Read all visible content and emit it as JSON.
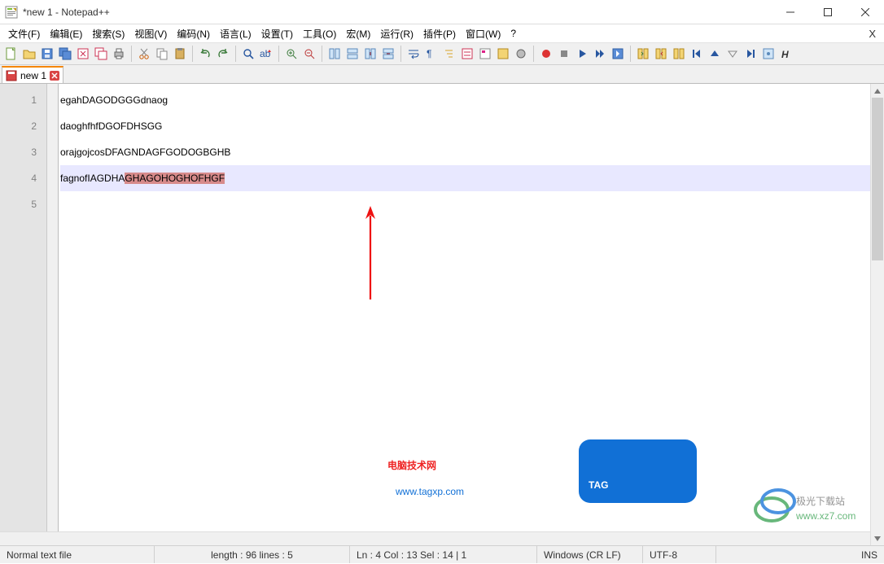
{
  "window": {
    "title": "*new 1 - Notepad++"
  },
  "menus": {
    "file": "文件(F)",
    "edit": "编辑(E)",
    "search": "搜索(S)",
    "view": "视图(V)",
    "encoding": "编码(N)",
    "language": "语言(L)",
    "settings": "设置(T)",
    "tools": "工具(O)",
    "macro": "宏(M)",
    "run": "运行(R)",
    "plugins": "插件(P)",
    "window": "窗口(W)",
    "help": "?"
  },
  "tab": {
    "label": "new 1"
  },
  "editor": {
    "gutter": [
      "1",
      "2",
      "3",
      "4",
      "5"
    ],
    "line1": "egahDAGODGGGdnaog",
    "line2": "daoghfhfDGOFDHSGG",
    "line3": "orajgojcosDFAGNDAGFGODOGBGHB",
    "line4_pre": "fagnofIAGDHA",
    "line4_sel": "GHAGOHOGHOFHGF"
  },
  "status": {
    "fileType": "Normal text file",
    "lengthLines": "length : 96    lines : 5",
    "position": "Ln : 4    Col : 13    Sel : 14 | 1",
    "eol": "Windows (CR LF)",
    "encoding": "UTF-8",
    "insert": "INS"
  },
  "watermarks": {
    "label1": "电脑技术网",
    "url1": "www.tagxp.com",
    "tag": "TAG",
    "label2": "极光下载站",
    "url2": "www.xz7.com"
  }
}
